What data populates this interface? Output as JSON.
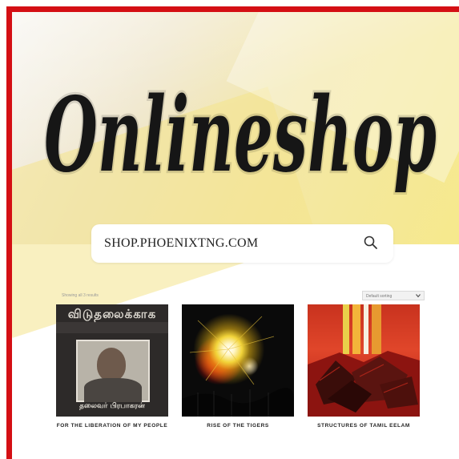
{
  "hero": {
    "logo_text": "Onlineshop",
    "search_text": "SHOP.PHOENIXTNG.COM"
  },
  "shop": {
    "results_count": "Showing all 3 results",
    "sort_value": "Default sorting"
  },
  "products": [
    {
      "title": "FOR THE LIBERATION OF MY PEOPLE",
      "cover_text_top": "விடுதலைக்காக",
      "cover_text_bottom": "தலைவர் பிரபாகரன்"
    },
    {
      "title": "RISE OF THE TIGERS"
    },
    {
      "title": "STRUCTURES OF TAMIL EELAM"
    }
  ],
  "colors": {
    "frame_border": "#d40f14",
    "hero_yellow": "#f6e98c"
  },
  "icons": {
    "search": "search-icon",
    "sort": "chevron-down-icon"
  }
}
